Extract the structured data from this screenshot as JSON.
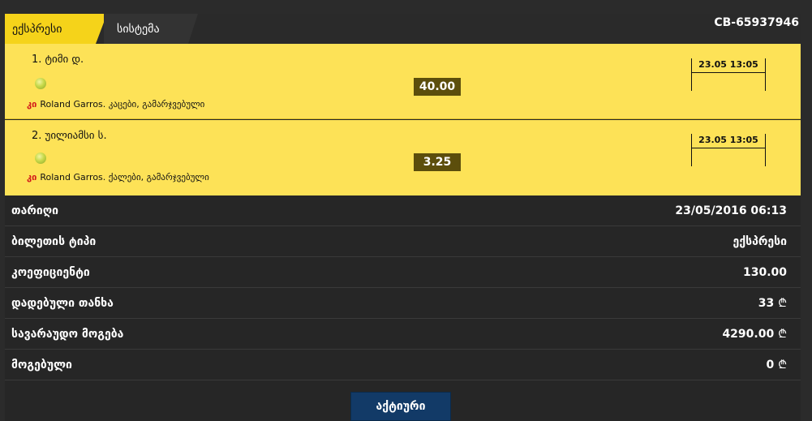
{
  "tabs": [
    {
      "label": "ექსპრესი",
      "active": true
    },
    {
      "label": "სისტემა",
      "active": false
    }
  ],
  "ticket_id": "CB-65937946",
  "events": [
    {
      "name": "1. ტიმი დ.",
      "sport_icon": "tennis-ball-icon",
      "league_code": "კი",
      "league": "Roland Garros. კაცები, გამარჯვებული",
      "odds": "40.00",
      "time": "23.05 13:05"
    },
    {
      "name": "2. უილიამსი ს.",
      "sport_icon": "tennis-ball-icon",
      "league_code": "კი",
      "league": "Roland Garros. ქალები, გამარჯვებული",
      "odds": "3.25",
      "time": "23.05 13:05"
    }
  ],
  "details": [
    {
      "label": "თარიღი",
      "value": "23/05/2016 06:13",
      "currency": ""
    },
    {
      "label": "ბილეთის ტიპი",
      "value": "ექსპრესი",
      "currency": ""
    },
    {
      "label": "კოეფიციენტი",
      "value": "130.00",
      "currency": ""
    },
    {
      "label": "დადებული თანხა",
      "value": "33",
      "currency": "₾"
    },
    {
      "label": "სავარაუდო მოგება",
      "value": "4290.00",
      "currency": "₾"
    },
    {
      "label": "მოგებული",
      "value": "0",
      "currency": "₾"
    }
  ],
  "status_button": "აქტიური",
  "colors": {
    "accent_yellow": "#f5d31a",
    "event_bg": "#fde257",
    "odds_bg": "#5c4e0c",
    "league_code": "#d21a1a",
    "status_button_bg": "#123a67"
  }
}
